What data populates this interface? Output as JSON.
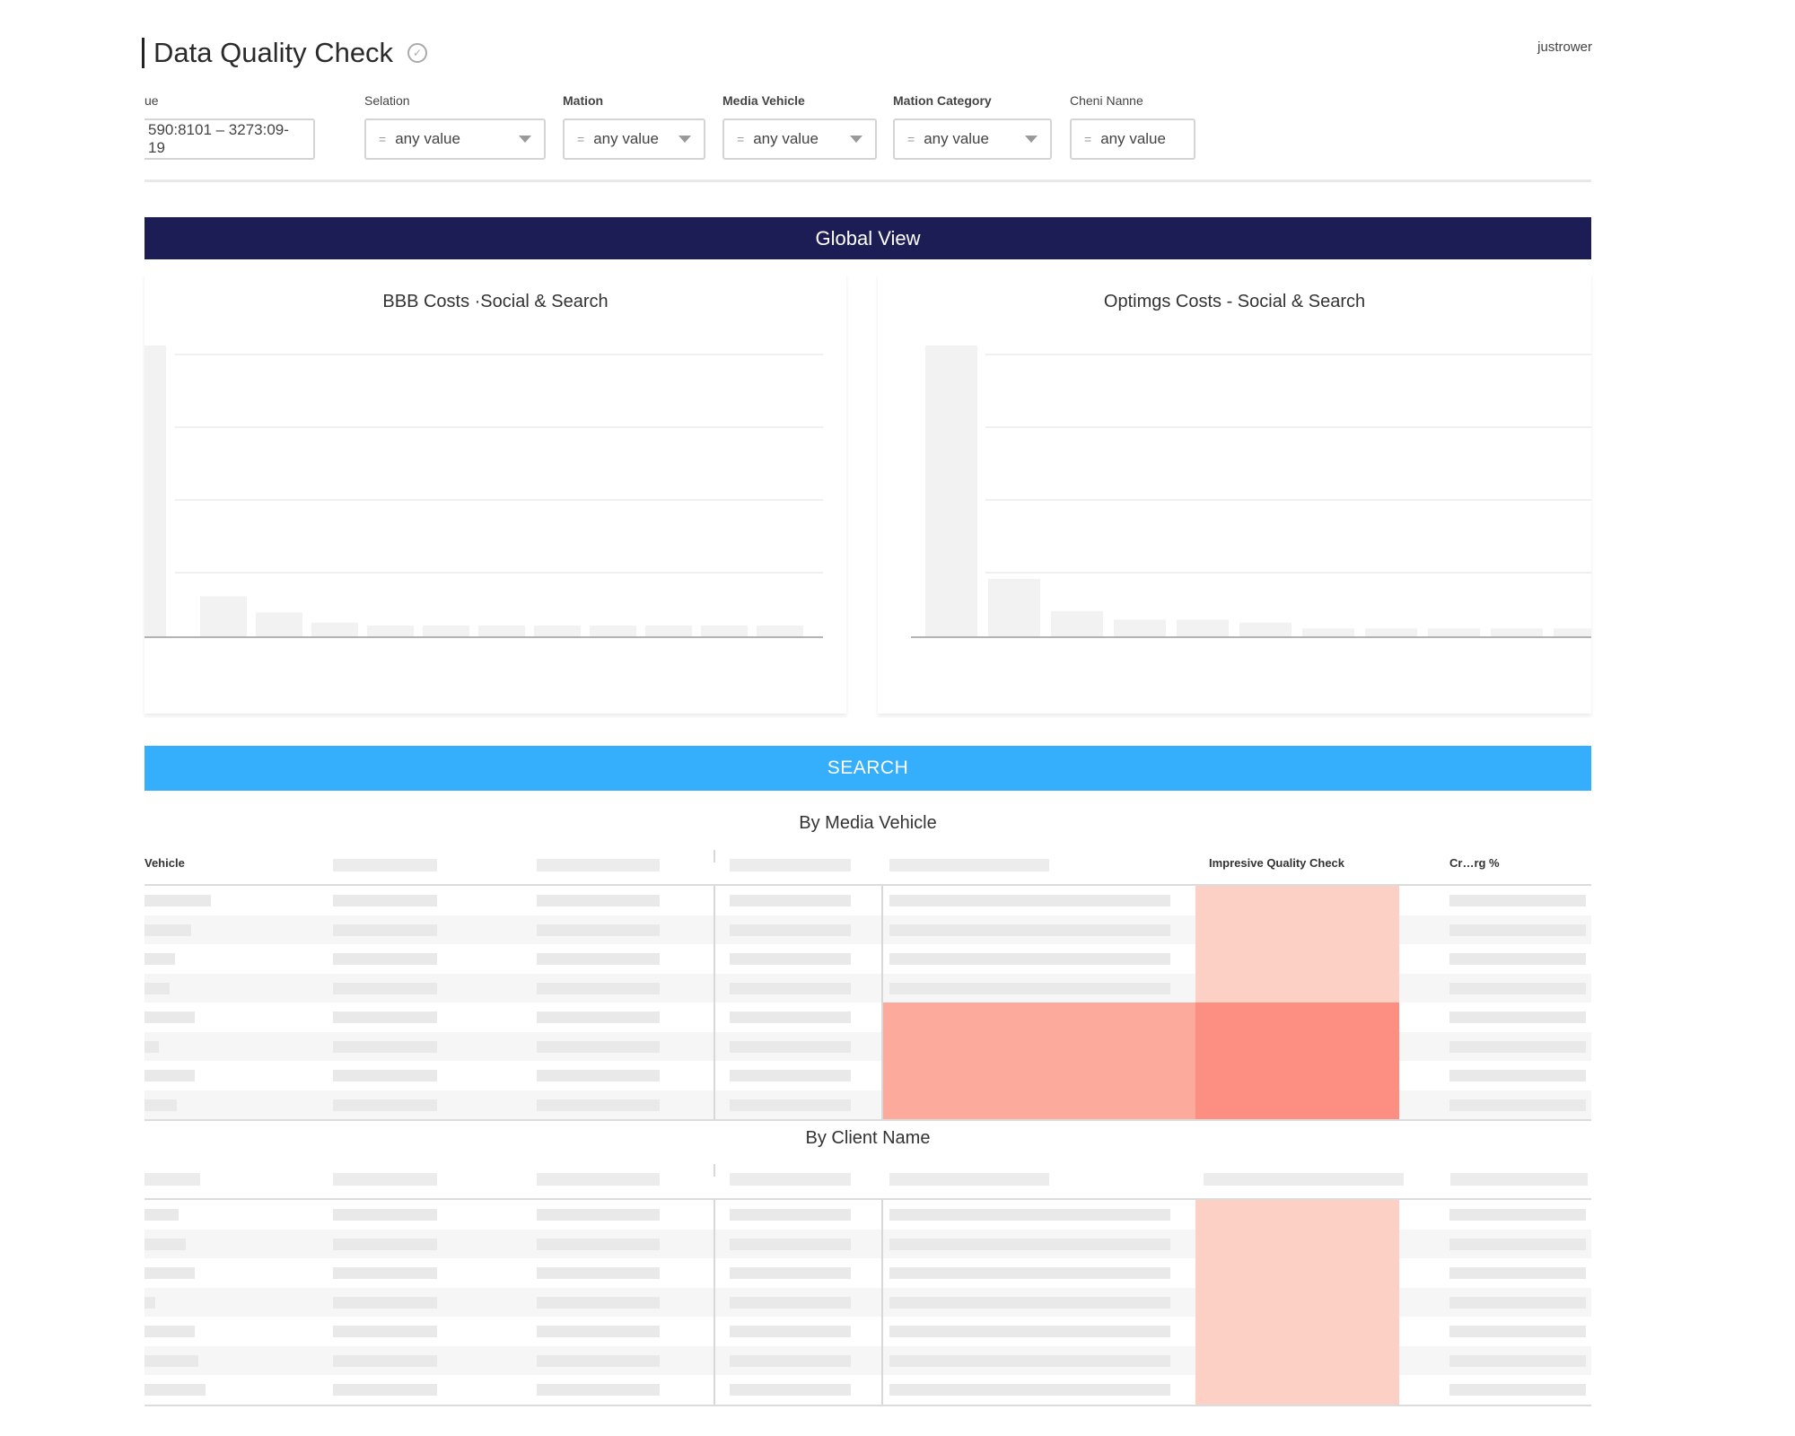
{
  "header": {
    "title": "Data Quality Check",
    "user": "justrower"
  },
  "filters": [
    {
      "label": "ue",
      "value": "590:8101 – 3273:09-19",
      "has_arrow": false,
      "has_eq": false
    },
    {
      "label": "Selation",
      "value": "any value",
      "has_arrow": true,
      "has_eq": true
    },
    {
      "label": "Mation",
      "value": "any value",
      "has_arrow": true,
      "has_eq": true
    },
    {
      "label": "Media Vehicle",
      "value": "any value",
      "has_arrow": true,
      "has_eq": true
    },
    {
      "label": "Mation Category",
      "value": "any value",
      "has_arrow": true,
      "has_eq": true
    },
    {
      "label": "Cheni Nanne",
      "value": "any value",
      "has_arrow": false,
      "has_eq": true
    }
  ],
  "sections": {
    "global": "Global View",
    "search": "SEARCH"
  },
  "chart_data": [
    {
      "type": "bar",
      "title": "BBB Costs ·Social & Search",
      "categories": [
        "",
        "",
        "",
        "",
        "",
        "",
        "",
        "",
        "",
        "",
        "",
        ""
      ],
      "values": [
        100,
        14,
        8.5,
        5,
        4,
        4,
        4,
        4,
        4,
        4,
        4,
        4
      ],
      "ylim": [
        0,
        100
      ],
      "grid": true,
      "bar_color": "#f2f2f2"
    },
    {
      "type": "bar",
      "title": "Optimgs Costs - Social & Search",
      "categories": [
        "",
        "",
        "",
        "",
        "",
        "",
        "",
        "",
        "",
        "",
        "",
        ""
      ],
      "values": [
        100,
        20,
        9,
        6,
        6,
        5,
        3,
        3,
        3,
        3,
        3,
        3
      ],
      "ylim": [
        0,
        100
      ],
      "grid": true,
      "bar_color": "#f2f2f2"
    }
  ],
  "tables": {
    "by_media_vehicle": {
      "title": "By Media Vehicle",
      "headers": [
        "Vehicle",
        "Impresive Quality Check",
        "Cr…rg %"
      ]
    },
    "by_client_name": {
      "title": "By Client Name"
    }
  },
  "colors": {
    "global_bar": "#1b1d54",
    "search_bar": "#35aefc",
    "heat_light": "#fdd0c6",
    "heat_medium": "#fcaa9c",
    "heat_strong": "#fc8f81"
  }
}
